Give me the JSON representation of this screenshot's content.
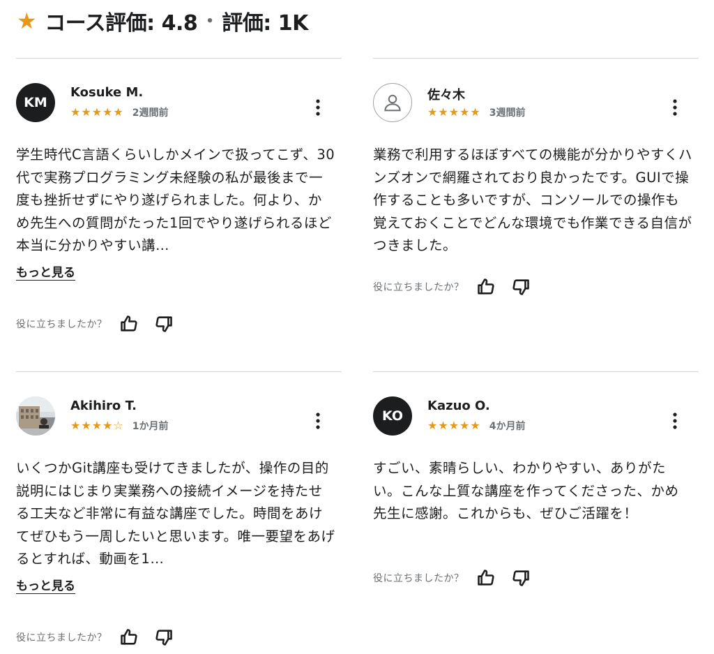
{
  "header": {
    "star_icon": "star-icon",
    "course_rating_label": "コース評価: 4.8",
    "separator": "•",
    "rating_count_label": "評価: 1K"
  },
  "colors": {
    "star": "#e59819",
    "text": "#1c1d1f",
    "muted": "#6a6f73",
    "divider": "#d1d7dc"
  },
  "reviews": [
    {
      "avatar_initials": "KM",
      "name": "Kosuke M.",
      "stars": "★★★★★",
      "rating": 5,
      "date": "2週間前",
      "body": "学生時代C言語くらいしかメインで扱ってこず、30代で実務プログラミング未経験の私が最後まで一度も挫折せずにやり遂げられました。何より、かめ先生への質問がたった1回でやり遂げられるほど本当に分かりやすい講…",
      "show_more": "もっと見る",
      "helpful": "役に立ちましたか？"
    },
    {
      "avatar_initials": "",
      "avatar_icon": "user-placeholder-icon",
      "name": "佐々木",
      "stars": "★★★★★",
      "rating": 5,
      "date": "3週間前",
      "body": "業務で利用するほぼすべての機能が分かりやすくハンズオンで網羅されており良かったです。GUIで操作することも多いですが、コンソールでの操作も覚えておくことでどんな環境でも作業できる自信がつきました。",
      "helpful": "役に立ちましたか？"
    },
    {
      "avatar_icon": "profile-photo",
      "name": "Akihiro T.",
      "stars": "★★★★☆",
      "rating": 4.5,
      "date": "1か月前",
      "body": "いくつかGit講座も受けてきましたが、操作の目的説明にはじまり実業務への接続イメージを持たせる工夫など非常に有益な講座でした。時間をあけてぜひもう一周したいと思います。唯一要望をあげるとすれば、動画を1…",
      "show_more": "もっと見る",
      "helpful": "役に立ちましたか？"
    },
    {
      "avatar_initials": "KO",
      "name": "Kazuo O.",
      "stars": "★★★★★",
      "rating": 5,
      "date": "4か月前",
      "body": "すごい、素晴らしい、わかりやすい、ありがたい。こんな上質な講座を作ってくださった、かめ先生に感謝。これからも、ぜひご活躍を！",
      "helpful": "役に立ちましたか？"
    }
  ]
}
